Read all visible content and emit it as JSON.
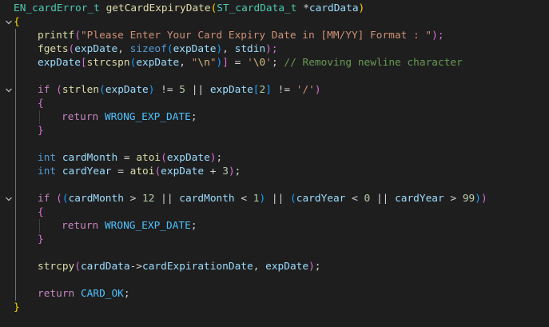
{
  "editor": {
    "lines": [
      [
        [
          "EN_cardError_t",
          "type"
        ],
        [
          " ",
          "plain"
        ],
        [
          "getCardExpiryDate",
          "fn"
        ],
        [
          "(",
          "bracket1"
        ],
        [
          "ST_cardData_t",
          "type"
        ],
        [
          " ",
          "plain"
        ],
        [
          "*",
          "plain"
        ],
        [
          "cardData",
          "var"
        ],
        [
          ")",
          "bracket1"
        ]
      ],
      [
        [
          "{",
          "bracket1"
        ]
      ],
      [
        [
          "printf",
          "fn"
        ],
        [
          "(",
          "bracket2"
        ],
        [
          "\"Please Enter Your Card Expiry Date in [MM/YY] Format : \"",
          "str"
        ],
        [
          ");",
          "bracket2"
        ]
      ],
      [
        [
          "fgets",
          "fn"
        ],
        [
          "(",
          "bracket2"
        ],
        [
          "expDate",
          "var"
        ],
        [
          ", ",
          "plain"
        ],
        [
          "sizeof",
          "kw"
        ],
        [
          "(",
          "bracket3"
        ],
        [
          "expDate",
          "var"
        ],
        [
          ")",
          "bracket3"
        ],
        [
          ", ",
          "plain"
        ],
        [
          "stdin",
          "var"
        ],
        [
          ");",
          "bracket2"
        ]
      ],
      [
        [
          "expDate",
          "var"
        ],
        [
          "[",
          "bracket2"
        ],
        [
          "strcspn",
          "fn"
        ],
        [
          "(",
          "bracket3"
        ],
        [
          "expDate",
          "var"
        ],
        [
          ", ",
          "plain"
        ],
        [
          "\"",
          "str"
        ],
        [
          "\\n",
          "esc"
        ],
        [
          "\"",
          "str"
        ],
        [
          ")",
          "bracket3"
        ],
        [
          "]",
          "bracket2"
        ],
        [
          " = ",
          "plain"
        ],
        [
          "'",
          "str"
        ],
        [
          "\\0",
          "esc"
        ],
        [
          "'",
          "str"
        ],
        [
          "; ",
          "plain"
        ],
        [
          "// Removing newline character",
          "cmt"
        ]
      ],
      [],
      [
        [
          "if",
          "ctrl"
        ],
        [
          " ",
          "plain"
        ],
        [
          "(",
          "bracket2"
        ],
        [
          "strlen",
          "fn"
        ],
        [
          "(",
          "bracket3"
        ],
        [
          "expDate",
          "var"
        ],
        [
          ")",
          "bracket3"
        ],
        [
          " != ",
          "plain"
        ],
        [
          "5",
          "num"
        ],
        [
          " || ",
          "plain"
        ],
        [
          "expDate",
          "var"
        ],
        [
          "[",
          "bracket3"
        ],
        [
          "2",
          "num"
        ],
        [
          "]",
          "bracket3"
        ],
        [
          " != ",
          "plain"
        ],
        [
          "'/'",
          "str"
        ],
        [
          ")",
          "bracket2"
        ]
      ],
      [
        [
          "{",
          "bracket2"
        ]
      ],
      [
        [
          "return",
          "ctrl"
        ],
        [
          " ",
          "plain"
        ],
        [
          "WRONG_EXP_DATE",
          "const"
        ],
        [
          ";",
          "plain"
        ]
      ],
      [
        [
          "}",
          "bracket2"
        ]
      ],
      [],
      [
        [
          "int",
          "kw"
        ],
        [
          " ",
          "plain"
        ],
        [
          "cardMonth",
          "var"
        ],
        [
          " = ",
          "plain"
        ],
        [
          "atoi",
          "fn"
        ],
        [
          "(",
          "bracket2"
        ],
        [
          "expDate",
          "var"
        ],
        [
          ")",
          "bracket2"
        ],
        [
          ";",
          "plain"
        ]
      ],
      [
        [
          "int",
          "kw"
        ],
        [
          " ",
          "plain"
        ],
        [
          "cardYear",
          "var"
        ],
        [
          " = ",
          "plain"
        ],
        [
          "atoi",
          "fn"
        ],
        [
          "(",
          "bracket2"
        ],
        [
          "expDate",
          "var"
        ],
        [
          " + ",
          "plain"
        ],
        [
          "3",
          "num"
        ],
        [
          ")",
          "bracket2"
        ],
        [
          ";",
          "plain"
        ]
      ],
      [],
      [
        [
          "if",
          "ctrl"
        ],
        [
          " ",
          "plain"
        ],
        [
          "(",
          "bracket2"
        ],
        [
          "(",
          "bracket3"
        ],
        [
          "cardMonth",
          "var"
        ],
        [
          " > ",
          "plain"
        ],
        [
          "12",
          "num"
        ],
        [
          " || ",
          "plain"
        ],
        [
          "cardMonth",
          "var"
        ],
        [
          " < ",
          "plain"
        ],
        [
          "1",
          "num"
        ],
        [
          ")",
          "bracket3"
        ],
        [
          " || ",
          "plain"
        ],
        [
          "(",
          "bracket3"
        ],
        [
          "cardYear",
          "var"
        ],
        [
          " < ",
          "plain"
        ],
        [
          "0",
          "num"
        ],
        [
          " || ",
          "plain"
        ],
        [
          "cardYear",
          "var"
        ],
        [
          " > ",
          "plain"
        ],
        [
          "99",
          "num"
        ],
        [
          ")",
          "bracket3"
        ],
        [
          ")",
          "bracket2"
        ]
      ],
      [
        [
          "{",
          "bracket2"
        ]
      ],
      [
        [
          "return",
          "ctrl"
        ],
        [
          " ",
          "plain"
        ],
        [
          "WRONG_EXP_DATE",
          "const"
        ],
        [
          ";",
          "plain"
        ]
      ],
      [
        [
          "}",
          "bracket2"
        ]
      ],
      [],
      [
        [
          "strcpy",
          "fn"
        ],
        [
          "(",
          "bracket2"
        ],
        [
          "cardData",
          "var"
        ],
        [
          "->",
          "plain"
        ],
        [
          "cardExpirationDate",
          "var"
        ],
        [
          ", ",
          "plain"
        ],
        [
          "expDate",
          "var"
        ],
        [
          ")",
          "bracket2"
        ],
        [
          ";",
          "plain"
        ]
      ],
      [],
      [
        [
          "return",
          "ctrl"
        ],
        [
          " ",
          "plain"
        ],
        [
          "CARD_OK",
          "const"
        ],
        [
          ";",
          "plain"
        ]
      ],
      [
        [
          "}",
          "bracket1"
        ]
      ]
    ]
  }
}
